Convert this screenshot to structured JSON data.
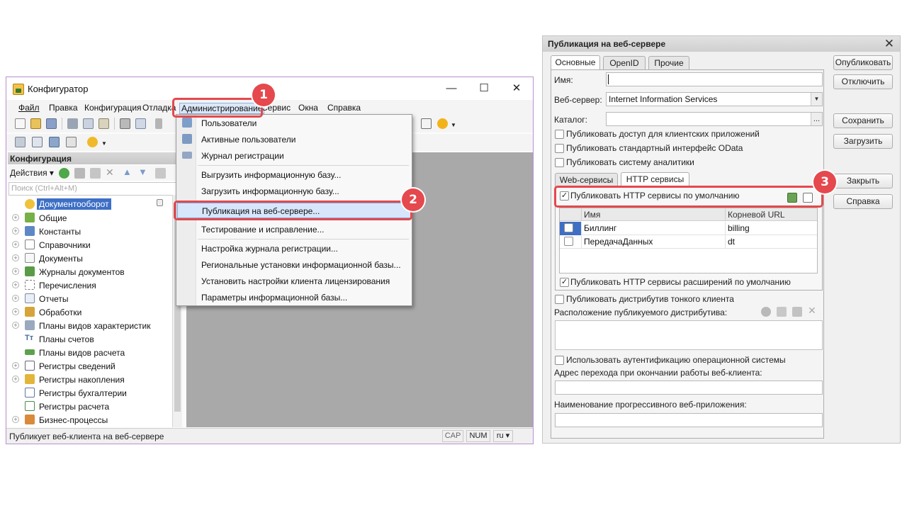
{
  "configurator": {
    "title": "Конфигуратор",
    "window_controls": {
      "minimize": "—",
      "maximize": "☐",
      "close": "✕"
    },
    "menu": [
      "Файл",
      "Правка",
      "Конфигурация",
      "Отладка",
      "Администрирование",
      "Сервис",
      "Окна",
      "Справка"
    ],
    "menu_active": "Администрирование",
    "panel": {
      "title": "Конфигурация",
      "actions_label": "Действия",
      "search_placeholder": "Поиск (Ctrl+Alt+M)",
      "tree": [
        {
          "label": "Документооборот",
          "selected": true,
          "icon": "config-root-icon"
        },
        {
          "label": "Общие",
          "icon": "common-icon"
        },
        {
          "label": "Константы",
          "icon": "constants-icon"
        },
        {
          "label": "Справочники",
          "icon": "catalogs-icon"
        },
        {
          "label": "Документы",
          "icon": "documents-icon"
        },
        {
          "label": "Журналы документов",
          "icon": "journals-icon"
        },
        {
          "label": "Перечисления",
          "icon": "enums-icon"
        },
        {
          "label": "Отчеты",
          "icon": "reports-icon"
        },
        {
          "label": "Обработки",
          "icon": "processing-icon"
        },
        {
          "label": "Планы видов характеристик",
          "icon": "charts-of-characteristics-icon"
        },
        {
          "label": "Планы счетов",
          "icon": "charts-of-accounts-icon"
        },
        {
          "label": "Планы видов расчета",
          "icon": "calculation-types-icon"
        },
        {
          "label": "Регистры сведений",
          "icon": "info-registers-icon"
        },
        {
          "label": "Регистры накопления",
          "icon": "accumulation-registers-icon"
        },
        {
          "label": "Регистры бухгалтерии",
          "icon": "accounting-registers-icon"
        },
        {
          "label": "Регистры расчета",
          "icon": "calculation-registers-icon"
        },
        {
          "label": "Бизнес-процессы",
          "icon": "business-processes-icon"
        }
      ]
    },
    "admin_menu": [
      "Пользователи",
      "Активные пользователи",
      "Журнал регистрации",
      "Выгрузить информационную базу...",
      "Загрузить информационную базу...",
      "Публикация на веб-сервере...",
      "Тестирование и исправление...",
      "Настройка журнала регистрации...",
      "Региональные установки информационной базы...",
      "Установить настройки клиента лицензирования",
      "Параметры информационной базы..."
    ],
    "status": {
      "text": "Публикует веб-клиента на веб-сервере",
      "cap": "CAP",
      "num": "NUM",
      "lang": "ru ▾"
    }
  },
  "callouts": {
    "one": "1",
    "two": "2",
    "three": "3",
    "color": "#e5484d"
  },
  "dialog": {
    "title": "Публикация на веб-сервере",
    "close": "✕",
    "tabs": [
      "Основные",
      "OpenID",
      "Прочие"
    ],
    "name_label": "Имя:",
    "name_value": "",
    "webserver_label": "Веб-сервер:",
    "webserver_value": "Internet Information Services",
    "catalog_label": "Каталог:",
    "catalog_value": "",
    "catalog_button": "...",
    "checks_top": [
      {
        "label": "Публиковать доступ для клиентских приложений",
        "checked": false
      },
      {
        "label": "Публиковать стандартный интерфейс OData",
        "checked": false
      },
      {
        "label": "Публиковать систему аналитики",
        "checked": false
      }
    ],
    "inner_tabs": [
      "Web-сервисы",
      "HTTP сервисы"
    ],
    "http_default": {
      "label": "Публиковать HTTP сервисы по умолчанию",
      "checked": true
    },
    "grid_headers": {
      "name": "Имя",
      "url": "Корневой URL"
    },
    "grid_rows": [
      {
        "name": "Биллинг",
        "url": "billing",
        "checked": false
      },
      {
        "name": "ПередачаДанных",
        "url": "dt",
        "checked": false
      }
    ],
    "http_ext": {
      "label": "Публиковать HTTP сервисы расширений по умолчанию",
      "checked": true
    },
    "thin_client": {
      "label": "Публиковать дистрибутив тонкого клиента",
      "checked": false
    },
    "distrib_location_label": "Расположение публикуемого дистрибутива:",
    "os_auth": {
      "label": "Использовать аутентификацию операционной системы",
      "checked": false
    },
    "exit_address_label": "Адрес перехода при окончании работы веб-клиента:",
    "pwa_label": "Наименование прогрессивного веб-приложения:",
    "buttons": [
      "Опубликовать",
      "Отключить",
      "Сохранить",
      "Загрузить",
      "Закрыть",
      "Справка"
    ]
  }
}
